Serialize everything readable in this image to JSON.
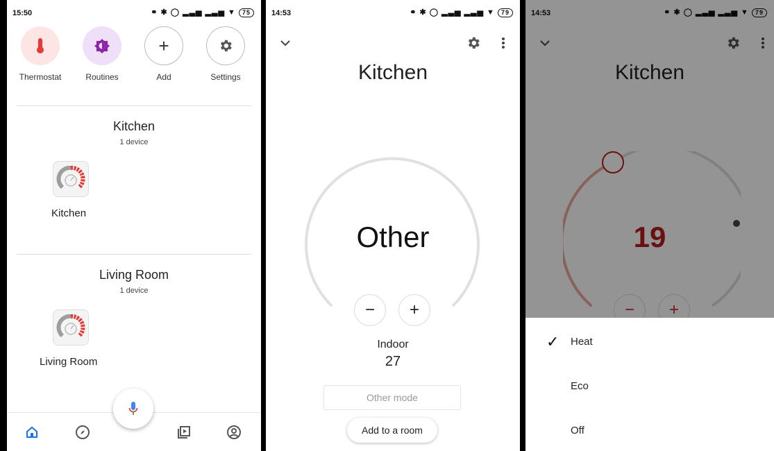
{
  "home": {
    "status": {
      "time": "15:50",
      "battery": "75"
    },
    "shortcuts": [
      {
        "label": "Thermostat",
        "icon": "thermometer-icon",
        "bg": "#fde5e3",
        "color": "#e53935"
      },
      {
        "label": "Routines",
        "icon": "routines-icon",
        "bg": "#f0dff8",
        "color": "#8e24aa"
      },
      {
        "label": "Add",
        "icon": "plus-icon"
      },
      {
        "label": "Settings",
        "icon": "gear-icon"
      }
    ],
    "rooms": [
      {
        "name": "Kitchen",
        "count": "1 device",
        "device": "Kitchen"
      },
      {
        "name": "Living Room",
        "count": "1 device",
        "device": "Living Room"
      }
    ],
    "nav": [
      "home-icon",
      "explore-icon",
      "mic-icon",
      "media-icon",
      "account-icon"
    ],
    "accent": "#1a73e8"
  },
  "thermostat": {
    "status": {
      "time": "14:53",
      "battery": "79"
    },
    "title": "Kitchen",
    "mode_display": "Other",
    "indoor_label": "Indoor",
    "indoor_value": "27",
    "mode_placeholder": "Other mode",
    "add_room_label": "Add to a room"
  },
  "mode_sheet": {
    "status": {
      "time": "14:53",
      "battery": "79"
    },
    "title": "Kitchen",
    "setpoint": "19",
    "setpoint_color": "#b71c1c",
    "options": [
      {
        "label": "Heat",
        "selected": true
      },
      {
        "label": "Eco",
        "selected": false
      },
      {
        "label": "Off",
        "selected": false
      }
    ]
  }
}
